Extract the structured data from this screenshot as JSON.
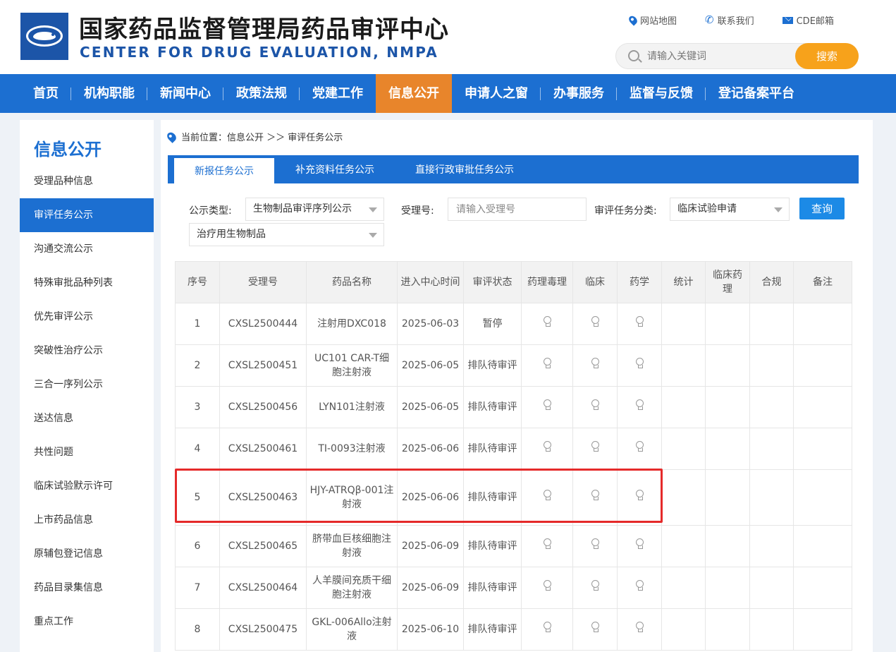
{
  "site": {
    "title_cn": "国家药品监督管理局药品审评中心",
    "title_en": "CENTER FOR DRUG EVALUATION, NMPA"
  },
  "toplinks": [
    "网站地图",
    "联系我们",
    "CDE邮箱"
  ],
  "search": {
    "placeholder": "请输入关键词",
    "button": "搜索"
  },
  "nav": [
    "首页",
    "机构职能",
    "新闻中心",
    "政策法规",
    "党建工作",
    "信息公开",
    "申请人之窗",
    "办事服务",
    "监督与反馈",
    "登记备案平台"
  ],
  "nav_active": "信息公开",
  "sidebar": {
    "title": "信息公开",
    "items": [
      "受理品种信息",
      "审评任务公示",
      "沟通交流公示",
      "特殊审批品种列表",
      "优先审评公示",
      "突破性治疗公示",
      "三合一序列公示",
      "送达信息",
      "共性问题",
      "临床试验默示许可",
      "上市药品信息",
      "原辅包登记信息",
      "药品目录集信息",
      "重点工作"
    ],
    "active": "审评任务公示"
  },
  "breadcrumb": "当前位置：信息公开 ＞＞ 审评任务公示",
  "tabs": [
    "新报任务公示",
    "补充资料任务公示",
    "直接行政审批任务公示"
  ],
  "filter": {
    "type_label": "公示类型:",
    "type_value": "生物制品审评序列公示",
    "accept_label": "受理号:",
    "accept_placeholder": "请输入受理号",
    "category_label": "审评任务分类:",
    "category_value": "临床试验申请",
    "subtype_value": "治疗用生物制品",
    "query_button": "查询"
  },
  "table": {
    "headers": [
      "序号",
      "受理号",
      "药品名称",
      "进入中心时间",
      "审评状态",
      "药理毒理",
      "临床",
      "药学",
      "统计",
      "临床药理",
      "合规",
      "备注"
    ],
    "rows": [
      {
        "no": "1",
        "id": "CXSL2500444",
        "name": "注射用DXC018",
        "date": "2025-06-03",
        "status": "暂停"
      },
      {
        "no": "2",
        "id": "CXSL2500451",
        "name": "UC101 CAR-T细胞注射液",
        "date": "2025-06-05",
        "status": "排队待审评"
      },
      {
        "no": "3",
        "id": "CXSL2500456",
        "name": "LYN101注射液",
        "date": "2025-06-05",
        "status": "排队待审评"
      },
      {
        "no": "4",
        "id": "CXSL2500461",
        "name": "TI-0093注射液",
        "date": "2025-06-06",
        "status": "排队待审评"
      },
      {
        "no": "5",
        "id": "CXSL2500463",
        "name": "HJY-ATRQβ-001注射液",
        "date": "2025-06-06",
        "status": "排队待审评"
      },
      {
        "no": "6",
        "id": "CXSL2500465",
        "name": "脐带血巨核细胞注射液",
        "date": "2025-06-09",
        "status": "排队待审评"
      },
      {
        "no": "7",
        "id": "CXSL2500464",
        "name": "人羊膜间充质干细胞注射液",
        "date": "2025-06-09",
        "status": "排队待审评"
      },
      {
        "no": "8",
        "id": "CXSL2500475",
        "name": "GKL-006Allo注射液",
        "date": "2025-06-10",
        "status": "排队待审评"
      }
    ]
  },
  "highlight_color": "#e52a2a"
}
